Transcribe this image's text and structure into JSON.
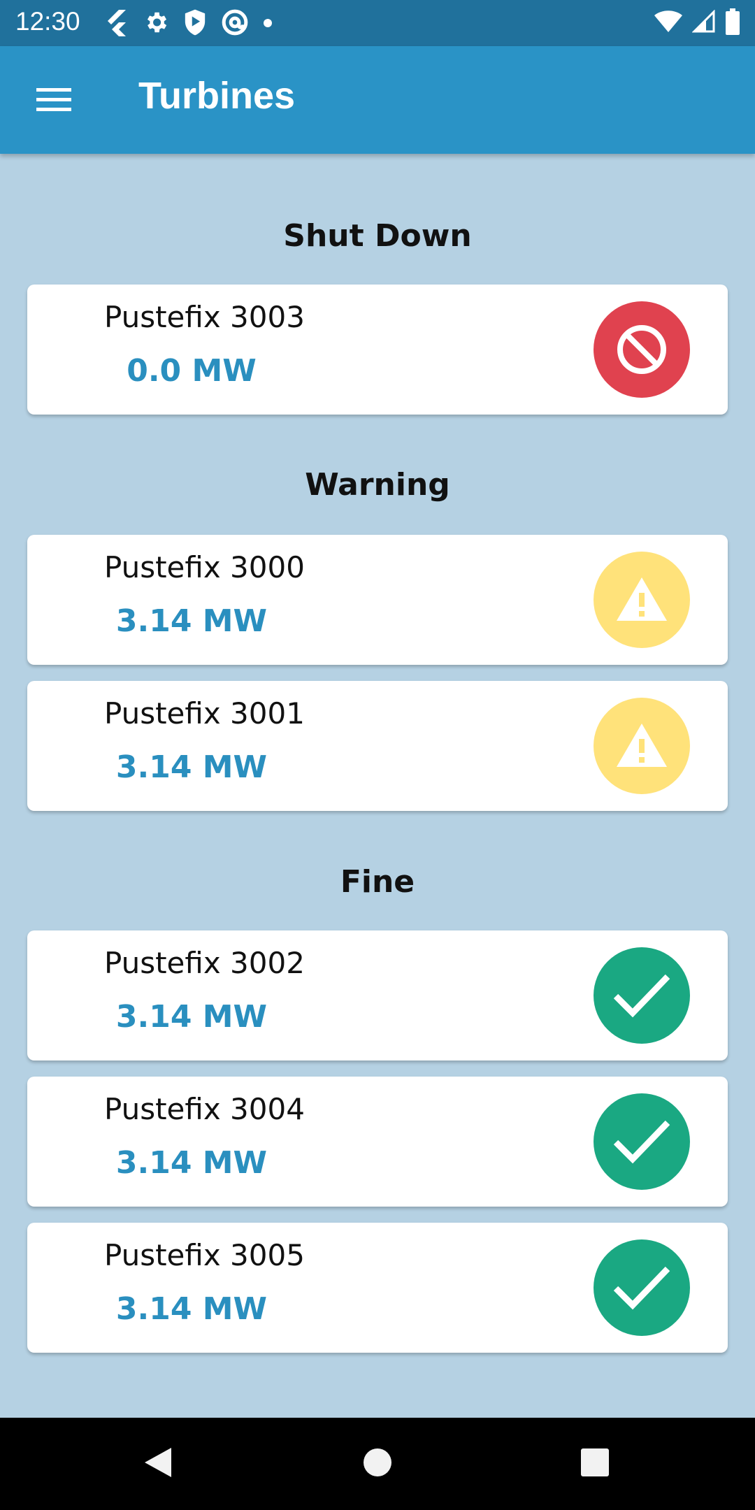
{
  "status_bar": {
    "time": "12:30",
    "left_icons": [
      "flutter-icon",
      "settings-icon",
      "shield-play-icon",
      "at-sign-icon",
      "dot-icon"
    ],
    "right_icons": [
      "wifi-icon",
      "cell-signal-icon",
      "battery-icon"
    ]
  },
  "app_bar": {
    "title": "Turbines",
    "menu_icon": "hamburger-menu-icon",
    "color": "#2a93c6"
  },
  "sections": [
    {
      "title": "Shut Down",
      "status": "shutdown",
      "status_icon": "block-icon",
      "status_color": "#e0424f",
      "turbines": [
        {
          "name": "Pustefix 3003",
          "power": "0.0 MW"
        }
      ]
    },
    {
      "title": "Warning",
      "status": "warning",
      "status_icon": "warning-icon",
      "status_color": "#ffe27a",
      "turbines": [
        {
          "name": "Pustefix 3000",
          "power": "3.14 MW"
        },
        {
          "name": "Pustefix 3001",
          "power": "3.14 MW"
        }
      ]
    },
    {
      "title": "Fine",
      "status": "fine",
      "status_icon": "check-icon",
      "status_color": "#1aa882",
      "turbines": [
        {
          "name": "Pustefix 3002",
          "power": "3.14 MW"
        },
        {
          "name": "Pustefix 3004",
          "power": "3.14 MW"
        },
        {
          "name": "Pustefix 3005",
          "power": "3.14 MW"
        }
      ]
    }
  ],
  "nav_bar": {
    "buttons": [
      "back-icon",
      "home-icon",
      "recents-icon"
    ]
  },
  "colors": {
    "background": "#b5d1e3",
    "power_text": "#2a8fbf",
    "status_bar": "#20719c"
  }
}
